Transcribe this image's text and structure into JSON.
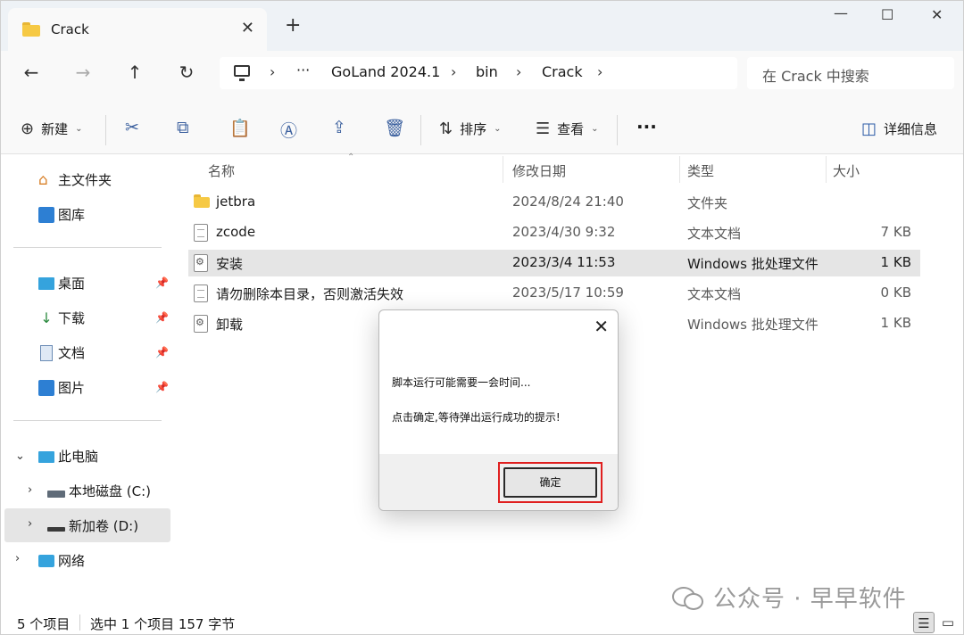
{
  "tab": {
    "title": "Crack",
    "close": "✕",
    "new_tab": "+"
  },
  "window_controls": {
    "minimize": "—",
    "maximize": "☐",
    "close": "✕"
  },
  "nav": {
    "back": "←",
    "forward": "→",
    "up": "↑",
    "refresh": "↻"
  },
  "address": {
    "ellipsis": "···",
    "crumbs": [
      "GoLand 2024.1",
      "bin",
      "Crack"
    ],
    "separator": "›"
  },
  "search": {
    "placeholder": "在 Crack 中搜索"
  },
  "commands": {
    "new_label": "新建",
    "sort_label": "排序",
    "view_label": "查看",
    "more": "···",
    "details_label": "详细信息"
  },
  "sidebar": {
    "home": "主文件夹",
    "gallery": "图库",
    "desktop": "桌面",
    "downloads": "下载",
    "documents": "文档",
    "pictures": "图片",
    "this_pc": "此电脑",
    "drive_c": "本地磁盘 (C:)",
    "drive_d": "新加卷 (D:)",
    "network": "网络"
  },
  "columns": {
    "name": "名称",
    "modified": "修改日期",
    "type": "类型",
    "size": "大小"
  },
  "files": [
    {
      "name": "jetbra",
      "modified": "2024/8/24 21:40",
      "type": "文件夹",
      "size": "",
      "icon": "folder-icon"
    },
    {
      "name": "zcode",
      "modified": "2023/4/30 9:32",
      "type": "文本文档",
      "size": "7 KB",
      "icon": "text-file-icon"
    },
    {
      "name": "安装",
      "modified": "2023/3/4 11:53",
      "type": "Windows 批处理文件",
      "size": "1 KB",
      "icon": "batch-file-icon"
    },
    {
      "name": "请勿删除本目录，否则激活失效",
      "modified": "2023/5/17 10:59",
      "type": "文本文档",
      "size": "0 KB",
      "icon": "text-file-icon"
    },
    {
      "name": "卸载",
      "modified": "",
      "type": "Windows 批处理文件",
      "size": "1 KB",
      "icon": "batch-file-icon"
    }
  ],
  "status": {
    "count": "5 个项目",
    "selection": "选中 1 个项目  157 字节"
  },
  "dialog": {
    "line1": "脚本运行可能需要一会时间...",
    "line2": "点击确定,等待弹出运行成功的提示!",
    "ok_label": "确定",
    "close": "✕"
  },
  "watermark": {
    "text": "公众号 · 早早软件"
  },
  "colors": {
    "accent": "#2b5aa6",
    "highlight_border": "#e02020",
    "selection": "#e5e5e5",
    "folder": "#f6c944"
  }
}
